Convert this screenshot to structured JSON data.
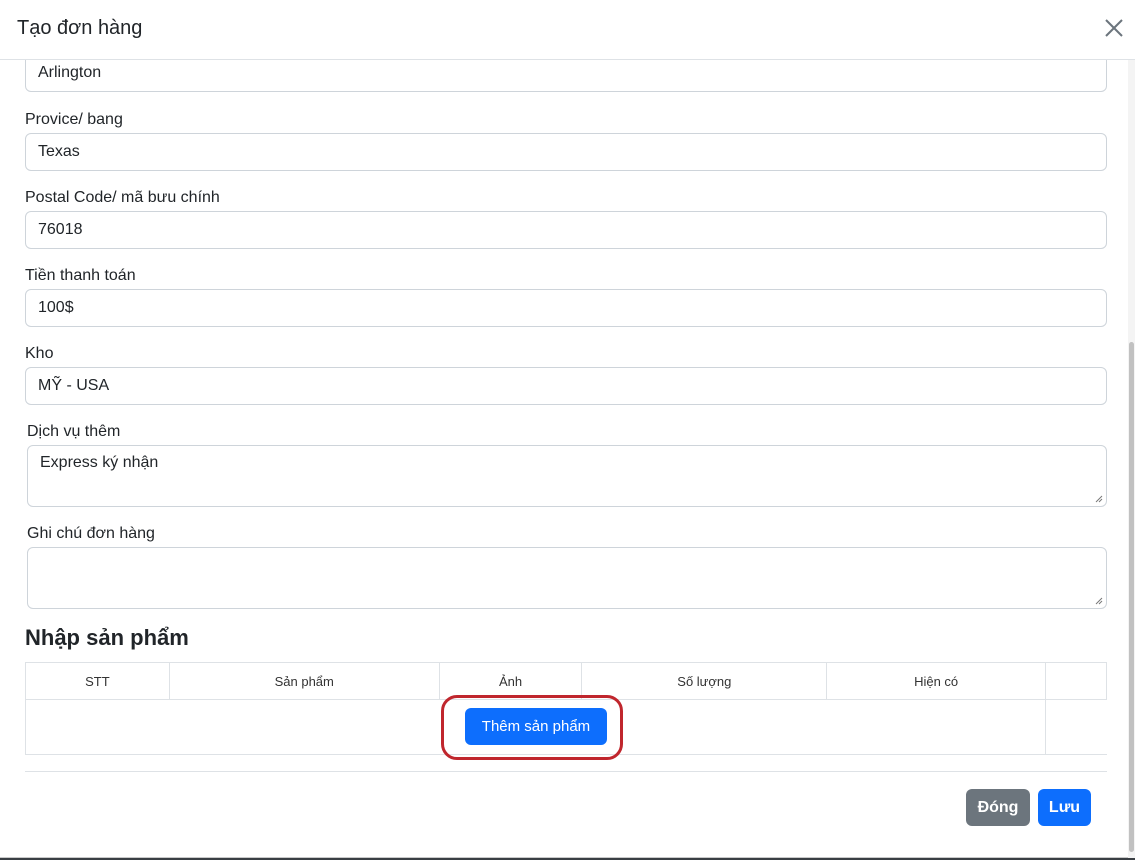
{
  "modal": {
    "title": "Tạo đơn hàng"
  },
  "form": {
    "city_value": "Arlington",
    "province_label": "Provice/ bang",
    "province_value": "Texas",
    "postal_label": "Postal Code/ mã bưu chính",
    "postal_value": "76018",
    "payment_label": "Tiền thanh toán",
    "payment_value": "100$",
    "warehouse_label": "Kho",
    "warehouse_value": "MỸ - USA",
    "service_label": "Dịch vụ thêm",
    "service_value": "Express ký nhận",
    "note_label": "Ghi chú đơn hàng",
    "note_value": ""
  },
  "products": {
    "title": "Nhập sản phẩm",
    "columns": [
      "STT",
      "Sản phẩm",
      "Ảnh",
      "Số lượng",
      "Hiện có",
      ""
    ],
    "add_button": "Thêm sản phẩm"
  },
  "footer": {
    "close_label": "Đóng",
    "save_label": "Lưu"
  },
  "colors": {
    "primary": "#0d6efd",
    "secondary": "#6c757d",
    "highlight": "#c0262d"
  }
}
